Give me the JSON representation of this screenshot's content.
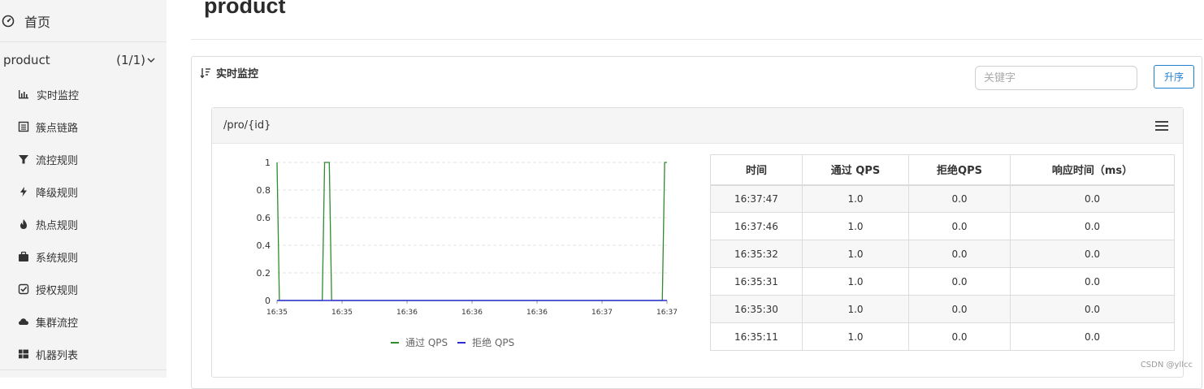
{
  "sidebar": {
    "home_label": "首页",
    "app": {
      "name": "product",
      "count": "(1/1)"
    },
    "items": [
      {
        "label": "实时监控",
        "icon": "bar-chart-icon"
      },
      {
        "label": "簇点链路",
        "icon": "list-icon"
      },
      {
        "label": "流控规则",
        "icon": "filter-icon"
      },
      {
        "label": "降级规则",
        "icon": "flash-icon"
      },
      {
        "label": "热点规则",
        "icon": "fire-icon"
      },
      {
        "label": "系统规则",
        "icon": "briefcase-icon"
      },
      {
        "label": "授权规则",
        "icon": "check-square-icon"
      },
      {
        "label": "集群流控",
        "icon": "cloud-icon"
      },
      {
        "label": "机器列表",
        "icon": "grid-icon"
      }
    ]
  },
  "page": {
    "title": "product"
  },
  "panel": {
    "title": "实时监控",
    "search_placeholder": "关键字",
    "sort_label": "升序"
  },
  "card": {
    "resource": "/pro/{id}"
  },
  "chart_data": {
    "type": "line",
    "x_tick_labels": [
      "16:35",
      "16:35",
      "16:36",
      "16:36",
      "16:36",
      "16:37",
      "16:37"
    ],
    "ylim": [
      0,
      1
    ],
    "y_ticks": [
      "0",
      "0.2",
      "0.4",
      "0.6",
      "0.8",
      "1"
    ],
    "grid": true,
    "legend_position": "bottom",
    "series": [
      {
        "name": "通过 QPS",
        "color": "#2e8b2e",
        "x": [
          0,
          0.006,
          0.116,
          0.122,
          0.134,
          0.14,
          0.988,
          0.994,
          1
        ],
        "values": [
          1,
          0,
          0,
          1,
          1,
          0,
          0,
          1,
          1
        ]
      },
      {
        "name": "拒绝 QPS",
        "color": "#2e2ed6",
        "x": [
          0,
          1
        ],
        "values": [
          0,
          0
        ]
      }
    ]
  },
  "table": {
    "headers": [
      "时间",
      "通过 QPS",
      "拒绝QPS",
      "响应时间（ms）"
    ],
    "rows": [
      [
        "16:37:47",
        "1.0",
        "0.0",
        "0.0"
      ],
      [
        "16:37:46",
        "1.0",
        "0.0",
        "0.0"
      ],
      [
        "16:35:32",
        "1.0",
        "0.0",
        "0.0"
      ],
      [
        "16:35:31",
        "1.0",
        "0.0",
        "0.0"
      ],
      [
        "16:35:30",
        "1.0",
        "0.0",
        "0.0"
      ],
      [
        "16:35:11",
        "1.0",
        "0.0",
        "0.0"
      ]
    ]
  },
  "watermark": "CSDN @yllcc"
}
